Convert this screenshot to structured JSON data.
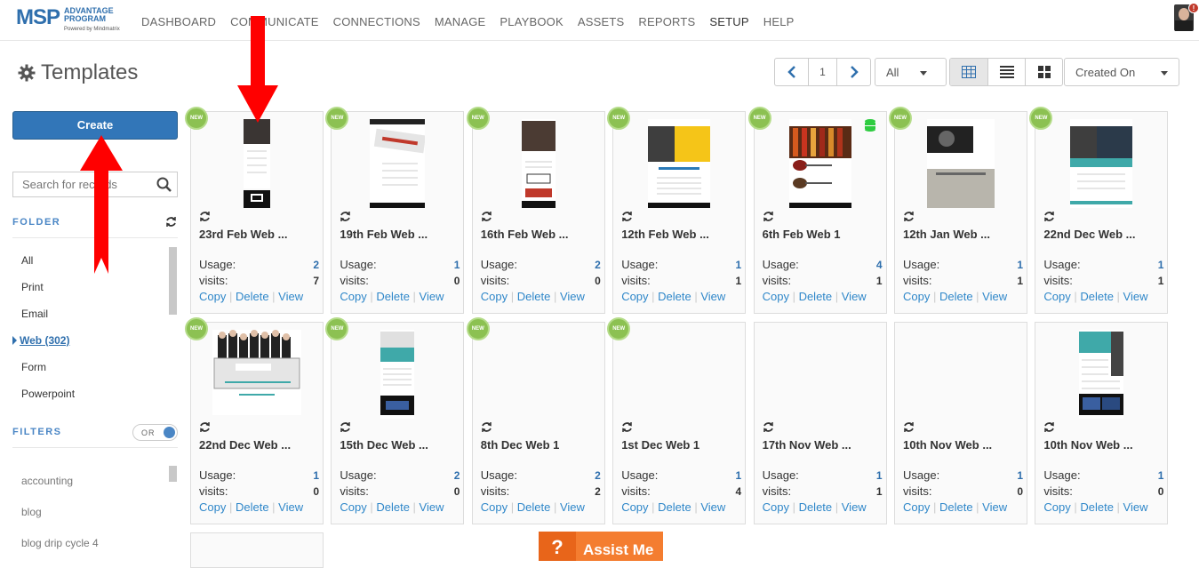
{
  "logo": {
    "msp": "MSP",
    "advantage": "ADVANTAGE",
    "program": "PROGRAM",
    "powered": "Powered by Mindmatrix"
  },
  "nav": [
    "DASHBOARD",
    "COMMUNICATE",
    "CONNECTIONS",
    "MANAGE",
    "PLAYBOOK",
    "ASSETS",
    "REPORTS",
    "SETUP",
    "HELP"
  ],
  "nav_active": "SETUP",
  "avatar_badge": "!",
  "page_title": "Templates",
  "toolbar": {
    "page": "1",
    "filter_value": "All",
    "sort_value": "Created On"
  },
  "sidebar": {
    "create_label": "Create",
    "search_placeholder": "Search for records",
    "folder_heading": "FOLDER",
    "folders": [
      "All",
      "Print",
      "Email",
      "Web (302)",
      "Form",
      "Powerpoint"
    ],
    "selected_folder": "Web (302)",
    "filters_heading": "FILTERS",
    "filters_toggle": "OR",
    "tags": [
      "accounting",
      "blog",
      "blog drip cycle 4"
    ]
  },
  "card_labels": {
    "usage": "Usage:",
    "visits": "visits:",
    "copy": "Copy",
    "delete": "Delete",
    "view": "View",
    "new": "NEW"
  },
  "cards": [
    {
      "name": "23rd Feb Web ...",
      "usage": "2",
      "visits": "7",
      "new": true
    },
    {
      "name": "19th Feb Web ...",
      "usage": "1",
      "visits": "0",
      "new": true
    },
    {
      "name": "16th Feb Web ...",
      "usage": "2",
      "visits": "0",
      "new": true
    },
    {
      "name": "12th Feb Web ...",
      "usage": "1",
      "visits": "1",
      "new": true
    },
    {
      "name": "6th Feb Web 1",
      "usage": "4",
      "visits": "1",
      "new": true
    },
    {
      "name": "12th Jan Web ...",
      "usage": "1",
      "visits": "1",
      "new": true
    },
    {
      "name": "22nd Dec Web ...",
      "usage": "1",
      "visits": "1",
      "new": true
    },
    {
      "name": "22nd Dec Web ...",
      "usage": "1",
      "visits": "0",
      "new": true
    },
    {
      "name": "15th Dec Web ...",
      "usage": "2",
      "visits": "0",
      "new": true
    },
    {
      "name": "8th Dec Web 1",
      "usage": "2",
      "visits": "2",
      "new": true
    },
    {
      "name": "1st Dec Web 1",
      "usage": "1",
      "visits": "4",
      "new": true
    },
    {
      "name": "17th Nov Web ...",
      "usage": "1",
      "visits": "1",
      "new": false
    },
    {
      "name": "10th Nov Web ...",
      "usage": "1",
      "visits": "0",
      "new": false
    },
    {
      "name": "10th Nov Web ...",
      "usage": "1",
      "visits": "0",
      "new": false
    }
  ],
  "assist": {
    "icon": "?",
    "label": "Assist Me"
  },
  "colors": {
    "accent": "#3276b8",
    "link": "#2f87c9",
    "new_badge": "#8cc152",
    "arrow": "#ff0000",
    "assist": "#f47d30"
  }
}
